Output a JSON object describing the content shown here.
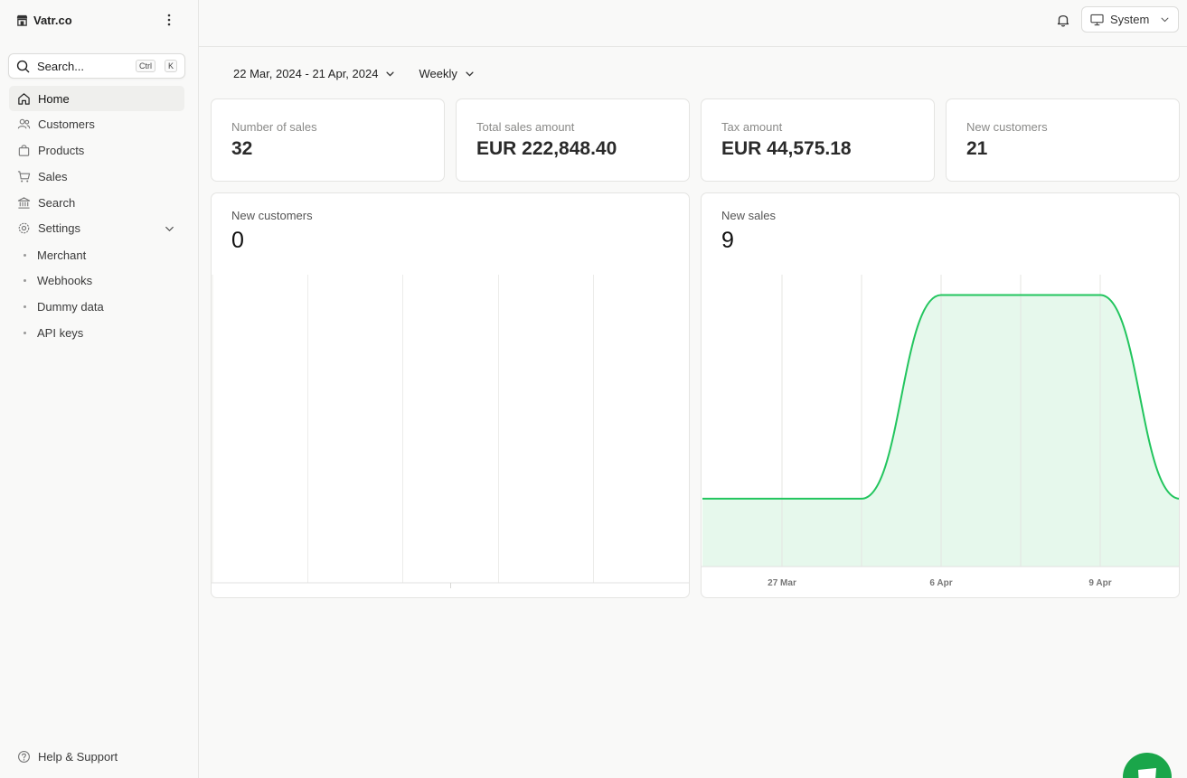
{
  "sidebar": {
    "brand": "Vatr.co",
    "search": {
      "label": "Search...",
      "kbd_ctrl": "Ctrl",
      "kbd_k": "K"
    },
    "nav": [
      {
        "label": "Home",
        "icon": "home-icon",
        "active": true
      },
      {
        "label": "Customers",
        "icon": "users-icon"
      },
      {
        "label": "Products",
        "icon": "bag-icon"
      },
      {
        "label": "Sales",
        "icon": "cart-icon"
      },
      {
        "label": "Search",
        "icon": "bank-icon"
      },
      {
        "label": "Settings",
        "icon": "gear-icon",
        "expanded": true
      }
    ],
    "settings_sub": [
      {
        "label": "Merchant"
      },
      {
        "label": "Webhooks"
      },
      {
        "label": "Dummy data"
      },
      {
        "label": "API keys"
      }
    ],
    "help": "Help & Support"
  },
  "topbar": {
    "theme": "System"
  },
  "filters": {
    "date_range": "22 Mar, 2024 - 21 Apr, 2024",
    "interval": "Weekly"
  },
  "stats": [
    {
      "label": "Number of sales",
      "value": "32"
    },
    {
      "label": "Total sales amount",
      "value": "EUR 222,848.40"
    },
    {
      "label": "Tax amount",
      "value": "EUR 44,575.18"
    },
    {
      "label": "New customers",
      "value": "21"
    }
  ],
  "charts": {
    "customers": {
      "label": "New customers",
      "value": "0"
    },
    "sales": {
      "label": "New sales",
      "value": "9"
    }
  },
  "chart_data": [
    {
      "type": "line",
      "title": "New customers",
      "x": [],
      "series": [
        {
          "values": []
        }
      ]
    },
    {
      "type": "area",
      "title": "New sales",
      "x": [
        "",
        "27 Mar",
        "",
        "6 Apr",
        "",
        "9 Apr",
        ""
      ],
      "series": [
        {
          "values": [
            1,
            1,
            1,
            4,
            4,
            4,
            1
          ]
        }
      ],
      "ylim": [
        0,
        4.3
      ],
      "grid": true,
      "color": "#22c55e",
      "fill": "#e6f8ec"
    }
  ],
  "colors": {
    "accent": "#22c55e",
    "fab": "#1aa64a"
  }
}
